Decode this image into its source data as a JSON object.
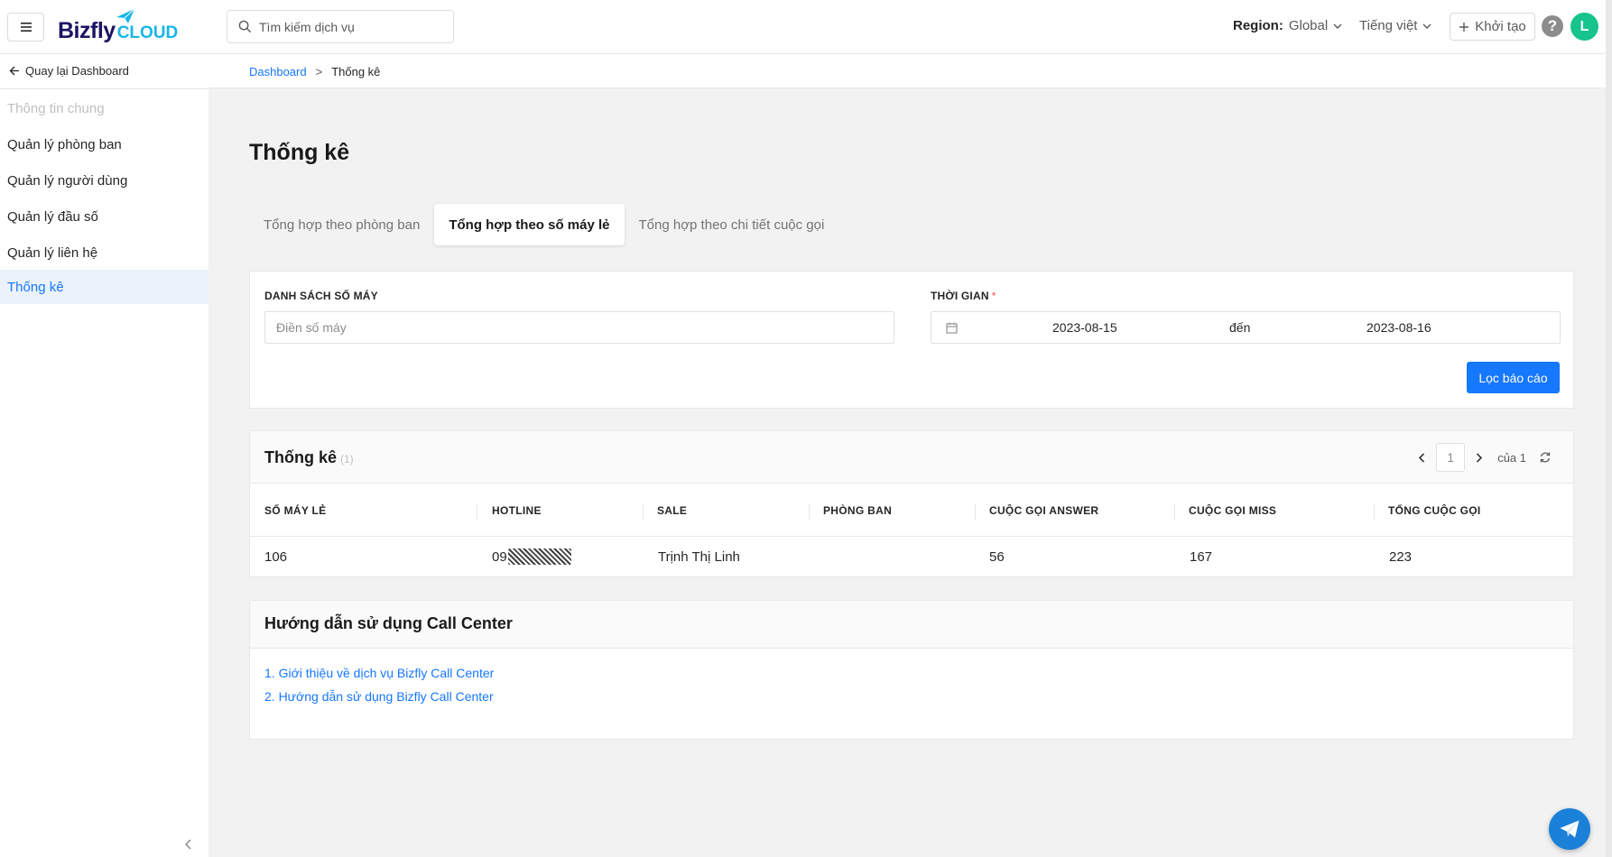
{
  "header": {
    "logo_main": "Bizfly",
    "logo_sub": "CLOUD",
    "search_placeholder": "Tìm kiếm dịch vụ",
    "region_label": "Region:",
    "region_value": "Global",
    "language": "Tiếng việt",
    "create_label": "Khởi tạo",
    "help_symbol": "?",
    "avatar_initial": "L"
  },
  "sidebar": {
    "back_label": "Quay lại Dashboard",
    "items": [
      {
        "label": "Thông tin chung",
        "state": "disabled"
      },
      {
        "label": "Quản lý phòng ban",
        "state": "normal"
      },
      {
        "label": "Quản lý người dùng",
        "state": "normal"
      },
      {
        "label": "Quản lý đầu số",
        "state": "normal"
      },
      {
        "label": "Quản lý liên hệ",
        "state": "normal"
      },
      {
        "label": "Thống kê",
        "state": "active"
      }
    ]
  },
  "breadcrumb": {
    "root": "Dashboard",
    "separator": ">",
    "current": "Thống kê"
  },
  "page": {
    "title": "Thống kê",
    "tabs": [
      {
        "label": "Tổng hợp theo phòng ban",
        "active": false
      },
      {
        "label": "Tổng hợp theo số máy lẻ",
        "active": true
      },
      {
        "label": "Tổng hợp theo chi tiết cuộc gọi",
        "active": false
      }
    ]
  },
  "filter": {
    "extensions_label": "DANH SÁCH SỐ MÁY",
    "extensions_placeholder": "Điền số máy",
    "time_label": "THỜI GIAN",
    "required_mark": "*",
    "date_from": "2023-08-15",
    "date_sep": "đến",
    "date_to": "2023-08-16",
    "submit_label": "Lọc báo cáo"
  },
  "stats": {
    "title": "Thống kê",
    "count": "(1)",
    "page_current": "1",
    "page_total_text": "của 1",
    "columns": [
      "SỐ MÁY LẺ",
      "HOTLINE",
      "SALE",
      "PHÒNG BAN",
      "CUỘC GỌI ANSWER",
      "CUỘC GỌI MISS",
      "TỔNG CUỘC GỌI"
    ],
    "rows": [
      {
        "extension": "106",
        "hotline_prefix": "09",
        "sale": "Trịnh Thị Linh",
        "department": "",
        "answered": "56",
        "missed": "167",
        "total": "223"
      }
    ]
  },
  "guide": {
    "title": "Hướng dẫn sử dụng Call Center",
    "links": [
      "1. Giới thiệu về dịch vụ Bizfly Call Center",
      "2. Hướng dẫn sử dụng Bizfly Call Center"
    ]
  },
  "colors": {
    "primary": "#1677ff",
    "avatar_bg": "#17c48c",
    "active_side_bg": "#ebf2fb",
    "fab_bg": "#1b80d8"
  }
}
